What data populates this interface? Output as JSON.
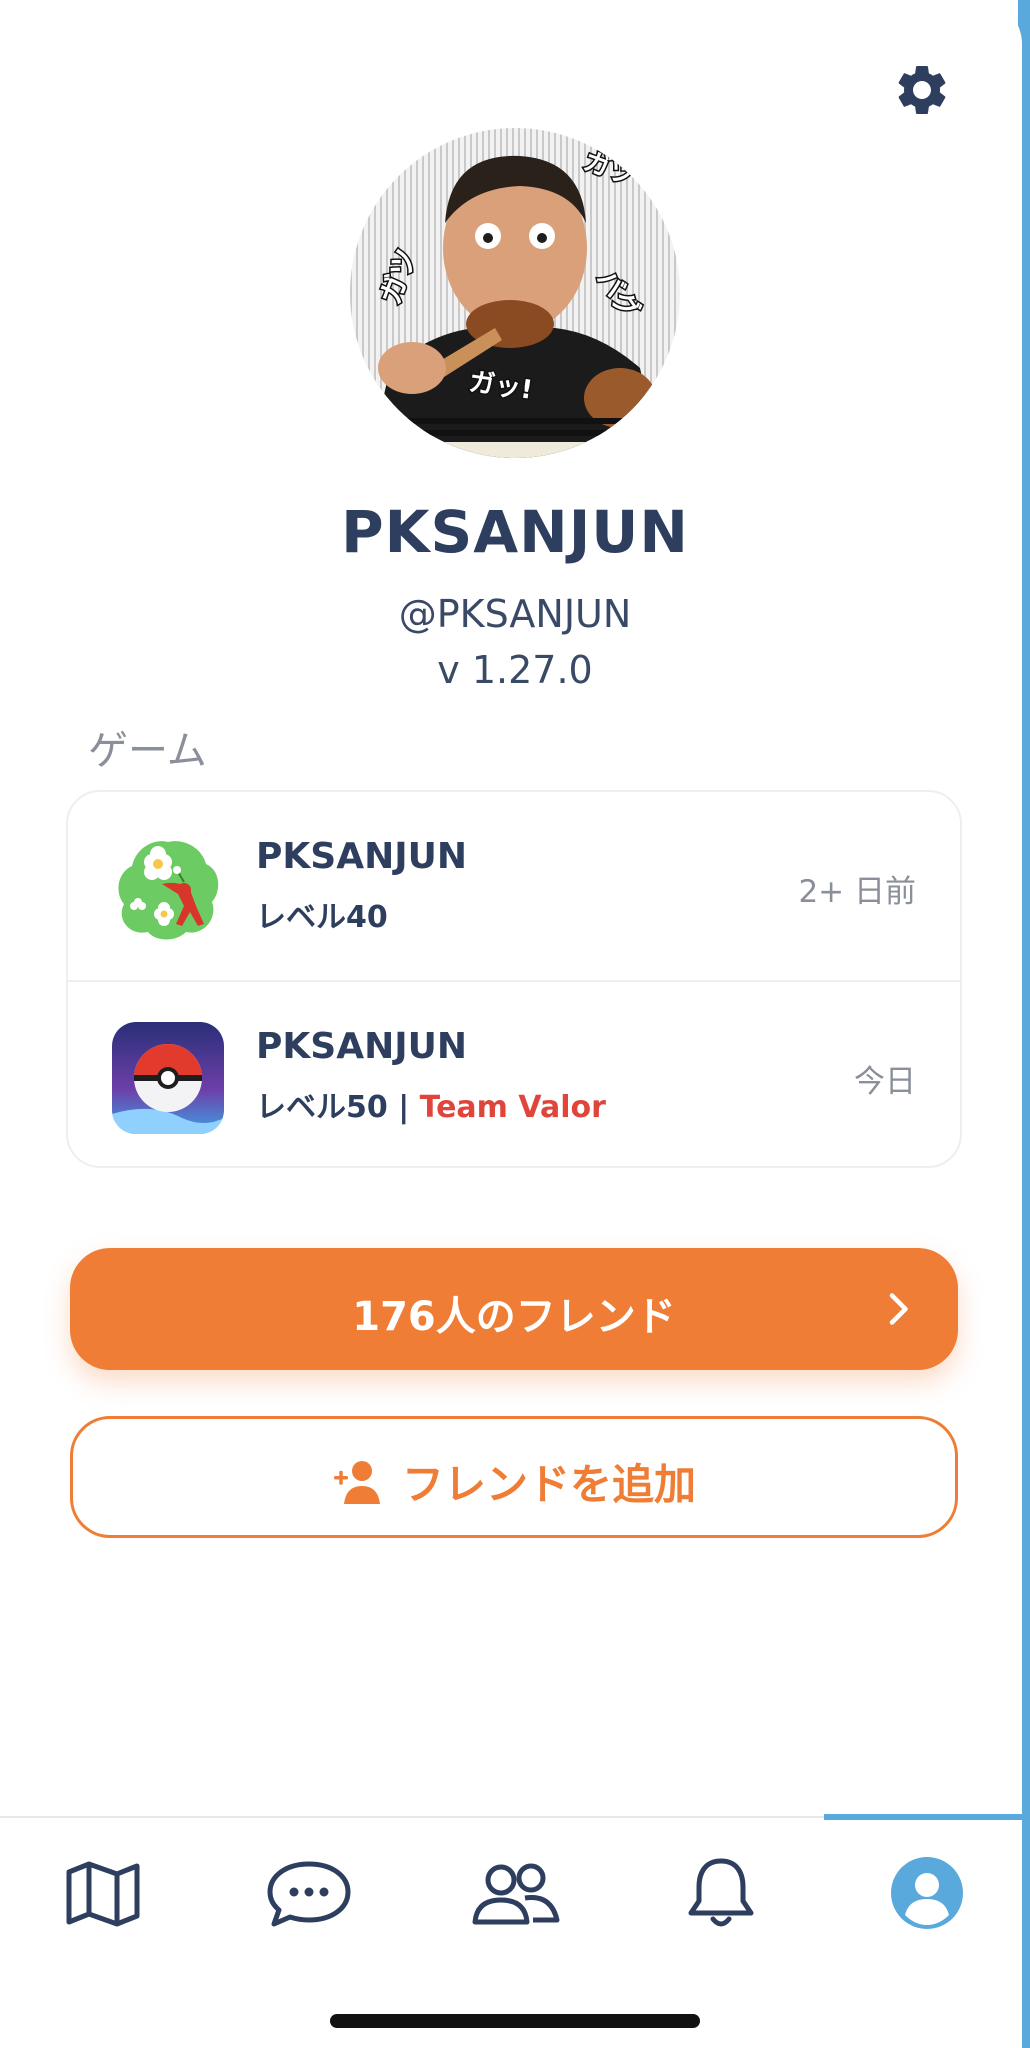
{
  "profile": {
    "display_name": "PKSANJUN",
    "handle": "@PKSANJUN",
    "version": "v 1.27.0",
    "avatar_caption": "ガツ！ バグ ガツ ガッ！"
  },
  "games_section": {
    "title": "ゲーム",
    "items": [
      {
        "icon": "pikmin-bloom-app-icon",
        "name": "PKSANJUN",
        "level": "レベル40",
        "last_seen": "2+ 日前"
      },
      {
        "icon": "pokemon-go-app-icon",
        "name": "PKSANJUN",
        "level": "レベル50 | ",
        "team": "Team Valor",
        "last_seen": "今日"
      }
    ]
  },
  "actions": {
    "friends_button": "176人のフレンド",
    "add_friend_button": "フレンドを追加"
  },
  "bottom_nav": {
    "items": [
      {
        "icon": "map-icon",
        "active": false
      },
      {
        "icon": "chat-icon",
        "active": false
      },
      {
        "icon": "friends-icon",
        "active": false
      },
      {
        "icon": "bell-icon",
        "active": false
      },
      {
        "icon": "profile-icon",
        "active": true
      }
    ]
  },
  "colors": {
    "primary_text": "#2d3e5e",
    "muted_text": "#8a8f99",
    "accent_orange": "#ef7d35",
    "accent_blue": "#5aa9dd",
    "team_valor_red": "#e0453b"
  }
}
